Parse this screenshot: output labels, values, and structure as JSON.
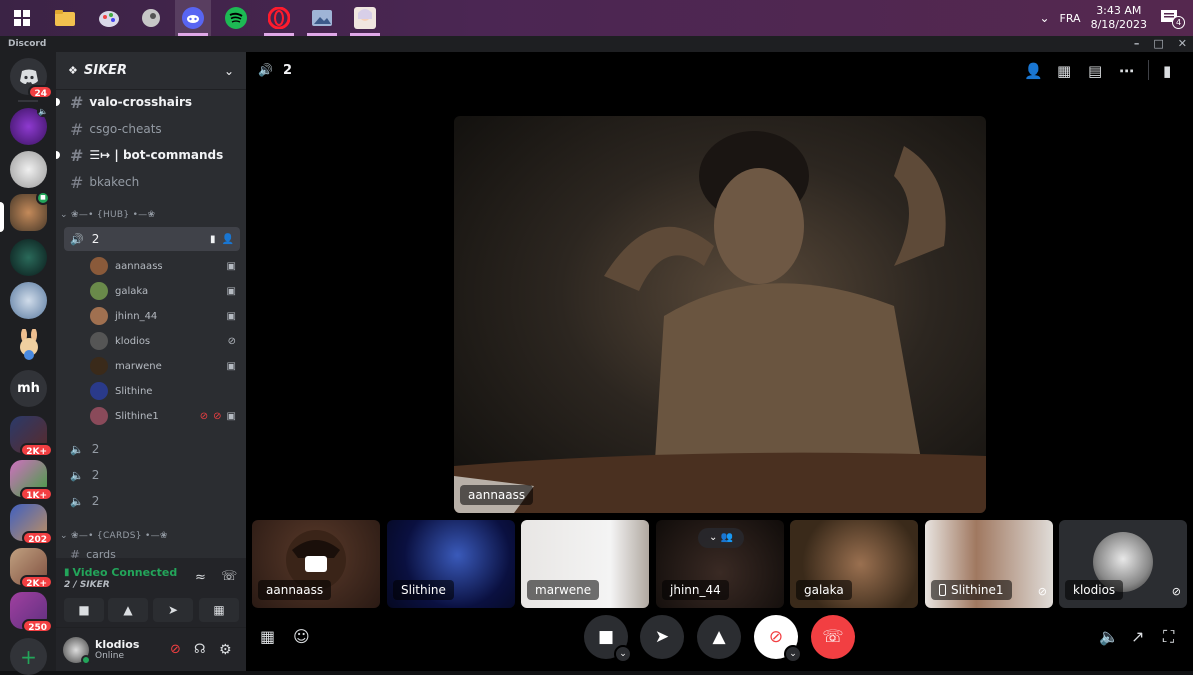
{
  "taskbar": {
    "lang": "FRA",
    "time": "3:43 AM",
    "date": "8/18/2023",
    "notif_count": "4"
  },
  "app": {
    "title": "Discord"
  },
  "guild_badges": [
    "24",
    "2K+",
    "1K+",
    "202",
    "2K+",
    "250"
  ],
  "guild_text_initials": "mh",
  "server": {
    "name": "SIKER"
  },
  "channels": [
    {
      "name": "valo-crosshairs",
      "unread": true
    },
    {
      "name": "csgo-cheats",
      "unread": false
    },
    {
      "name": "☰↦ | bot-commands",
      "unread": true
    },
    {
      "name": "bkakech",
      "unread": false
    }
  ],
  "category_hub": "❀—• {HUB} •—❀",
  "voice_active": {
    "name": "2"
  },
  "voice_users": [
    {
      "name": "aannaass",
      "color": "#8a5a3a"
    },
    {
      "name": "galaka",
      "color": "#6a8a4a"
    },
    {
      "name": "jhinn_44",
      "color": "#a07050"
    },
    {
      "name": "klodios",
      "color": "#555"
    },
    {
      "name": "marwene",
      "color": "#3a2a1a"
    },
    {
      "name": "Slithine",
      "color": "#2a3a8a"
    },
    {
      "name": "Slithine1",
      "color": "#8a4a5a"
    }
  ],
  "voice_other": [
    "2",
    "2",
    "2"
  ],
  "category_cards": "❀—• {CARDS} •—❀",
  "partial_channel": "cards",
  "voice_panel": {
    "status": "Video Connected",
    "channel": "2 / SIKER"
  },
  "me": {
    "name": "klodios",
    "status": "Online"
  },
  "call": {
    "channel": "2",
    "main_label": "aannaass"
  },
  "tiles": [
    "aannaass",
    "Slithine",
    "marwene",
    "jhinn_44",
    "galaka",
    "Slithine1",
    "klodios"
  ],
  "colors": {
    "accent": "#5865f2",
    "danger": "#f23f42",
    "success": "#23a55a"
  }
}
